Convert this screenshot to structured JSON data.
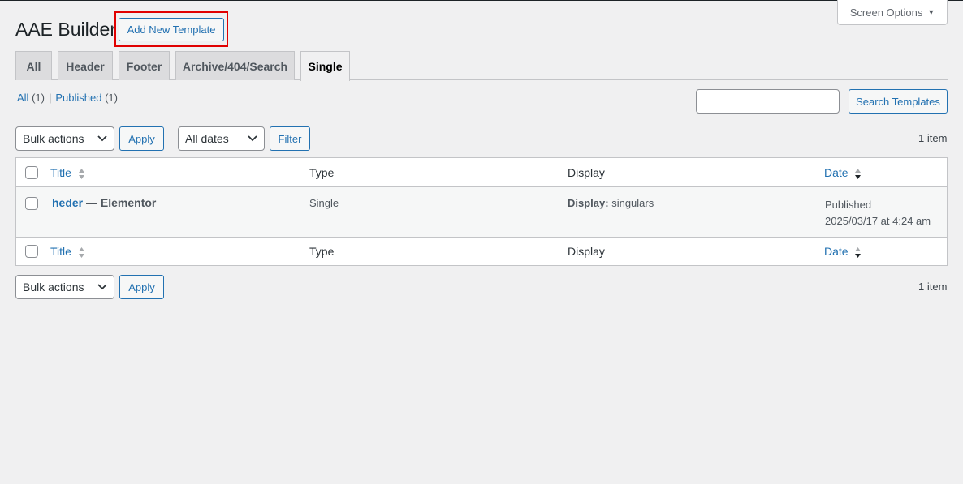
{
  "screen_options": {
    "label": "Screen Options",
    "caret": "▼"
  },
  "header": {
    "title": "AAE Builder",
    "add_new_label": "Add New Template"
  },
  "tabs": [
    {
      "label": "All",
      "active": false
    },
    {
      "label": "Header",
      "active": false
    },
    {
      "label": "Footer",
      "active": false
    },
    {
      "label": "Archive/404/Search",
      "active": false
    },
    {
      "label": "Single",
      "active": true
    }
  ],
  "views": {
    "all_label": "All",
    "all_count": "(1)",
    "separator": "|",
    "published_label": "Published",
    "published_count": "(1)"
  },
  "search": {
    "value": "",
    "button_label": "Search Templates"
  },
  "top_nav": {
    "bulk_actions": "Bulk actions",
    "apply_label": "Apply",
    "dates": "All dates",
    "filter_label": "Filter",
    "items_count": "1 item"
  },
  "table": {
    "columns": {
      "title": "Title",
      "type": "Type",
      "display": "Display",
      "date": "Date"
    },
    "rows": [
      {
        "title": "heder",
        "state_sep": "—",
        "state": "Elementor",
        "type": "Single",
        "display_label": "Display:",
        "display_value": "singulars",
        "date_status": "Published",
        "date_value": "2025/03/17 at 4:24 am"
      }
    ]
  },
  "bottom_nav": {
    "bulk_actions": "Bulk actions",
    "apply_label": "Apply",
    "items_count": "1 item"
  },
  "colors": {
    "accent": "#2271b1",
    "highlight_box": "#e00000",
    "background": "#f0f0f1"
  }
}
